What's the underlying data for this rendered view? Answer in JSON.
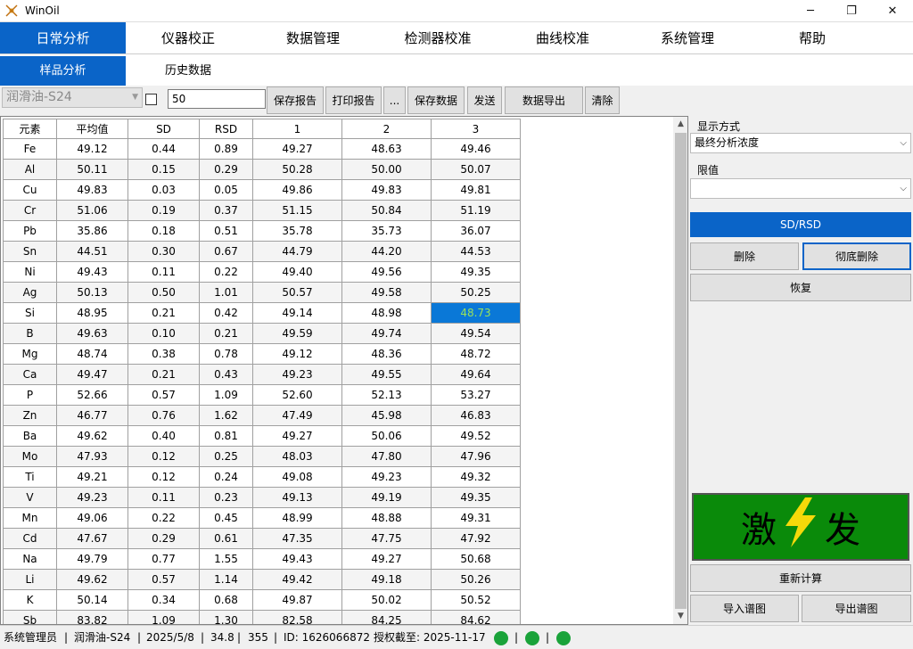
{
  "window": {
    "title": "WinOil",
    "minimize": "─",
    "maximize": "❐",
    "close": "✕"
  },
  "main_menu": [
    "日常分析",
    "仪器校正",
    "数据管理",
    "检测器校准",
    "曲线校准",
    "系统管理",
    "帮助"
  ],
  "sub_menu": [
    "样品分析",
    "历史数据"
  ],
  "toolbar": {
    "sample": "润滑油-S24",
    "count": "50",
    "buttons": [
      "保存报告",
      "打印报告",
      "...",
      "保存数据",
      "发送",
      "数据导出",
      "清除"
    ]
  },
  "table": {
    "headers": [
      "元素",
      "平均值",
      "SD",
      "RSD",
      "1",
      "2",
      "3"
    ],
    "rows": [
      [
        "Fe",
        "49.12",
        "0.44",
        "0.89",
        "49.27",
        "48.63",
        "49.46"
      ],
      [
        "Al",
        "50.11",
        "0.15",
        "0.29",
        "50.28",
        "50.00",
        "50.07"
      ],
      [
        "Cu",
        "49.83",
        "0.03",
        "0.05",
        "49.86",
        "49.83",
        "49.81"
      ],
      [
        "Cr",
        "51.06",
        "0.19",
        "0.37",
        "51.15",
        "50.84",
        "51.19"
      ],
      [
        "Pb",
        "35.86",
        "0.18",
        "0.51",
        "35.78",
        "35.73",
        "36.07"
      ],
      [
        "Sn",
        "44.51",
        "0.30",
        "0.67",
        "44.79",
        "44.20",
        "44.53"
      ],
      [
        "Ni",
        "49.43",
        "0.11",
        "0.22",
        "49.40",
        "49.56",
        "49.35"
      ],
      [
        "Ag",
        "50.13",
        "0.50",
        "1.01",
        "50.57",
        "49.58",
        "50.25"
      ],
      [
        "Si",
        "48.95",
        "0.21",
        "0.42",
        "49.14",
        "48.98",
        "48.73"
      ],
      [
        "B",
        "49.63",
        "0.10",
        "0.21",
        "49.59",
        "49.74",
        "49.54"
      ],
      [
        "Mg",
        "48.74",
        "0.38",
        "0.78",
        "49.12",
        "48.36",
        "48.72"
      ],
      [
        "Ca",
        "49.47",
        "0.21",
        "0.43",
        "49.23",
        "49.55",
        "49.64"
      ],
      [
        "P",
        "52.66",
        "0.57",
        "1.09",
        "52.60",
        "52.13",
        "53.27"
      ],
      [
        "Zn",
        "46.77",
        "0.76",
        "1.62",
        "47.49",
        "45.98",
        "46.83"
      ],
      [
        "Ba",
        "49.62",
        "0.40",
        "0.81",
        "49.27",
        "50.06",
        "49.52"
      ],
      [
        "Mo",
        "47.93",
        "0.12",
        "0.25",
        "48.03",
        "47.80",
        "47.96"
      ],
      [
        "Ti",
        "49.21",
        "0.12",
        "0.24",
        "49.08",
        "49.23",
        "49.32"
      ],
      [
        "V",
        "49.23",
        "0.11",
        "0.23",
        "49.13",
        "49.19",
        "49.35"
      ],
      [
        "Mn",
        "49.06",
        "0.22",
        "0.45",
        "48.99",
        "48.88",
        "49.31"
      ],
      [
        "Cd",
        "47.67",
        "0.29",
        "0.61",
        "47.35",
        "47.75",
        "47.92"
      ],
      [
        "Na",
        "49.79",
        "0.77",
        "1.55",
        "49.43",
        "49.27",
        "50.68"
      ],
      [
        "Li",
        "49.62",
        "0.57",
        "1.14",
        "49.42",
        "49.18",
        "50.26"
      ],
      [
        "K",
        "50.14",
        "0.34",
        "0.68",
        "49.87",
        "50.02",
        "50.52"
      ],
      [
        "Sb",
        "83.82",
        "1.09",
        "1.30",
        "82.58",
        "84.25",
        "84.62"
      ]
    ]
  },
  "right_panel": {
    "display_label": "显示方式",
    "display_value": "最终分析浓度",
    "limit_label": "限值",
    "limit_value": "",
    "sdrsd": "SD/RSD",
    "delete": "删除",
    "delete_all": "彻底删除",
    "restore": "恢复",
    "fire_left": "激",
    "fire_right": "发",
    "recalc": "重新计算",
    "import_spec": "导入谱图",
    "export_spec": "导出谱图"
  },
  "status": {
    "user": "系统管理员",
    "sample": "润滑油-S24",
    "date": "2025/5/8",
    "value1": "34.8",
    "value2": "355",
    "id": "ID: 1626066872",
    "license": "授权截至:  2025-11-17"
  },
  "colors": {
    "accent": "#0a64c8",
    "fire": "#0a8a0a",
    "selection": "#0a78d7",
    "status_ok": "#1aa33a"
  }
}
